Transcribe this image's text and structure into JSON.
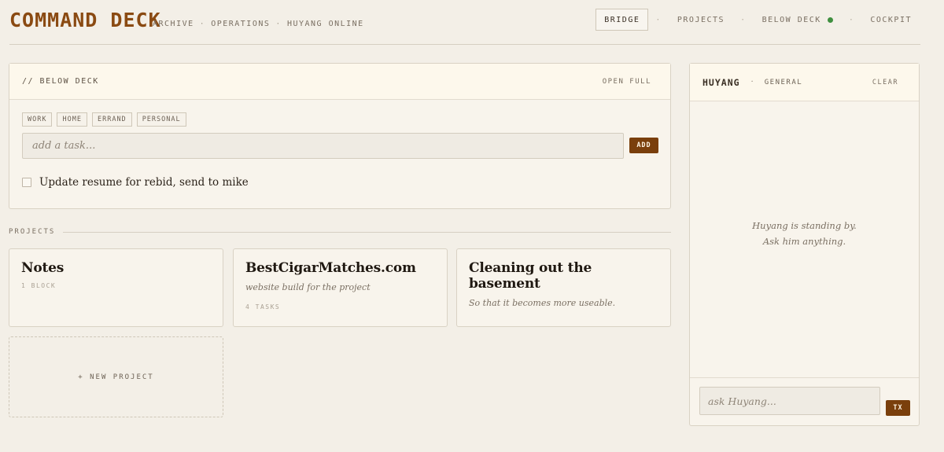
{
  "header": {
    "brand": "COMMAND DECK",
    "crumbs": [
      "ARCHIVE",
      "OPERATIONS",
      "HUYANG ONLINE"
    ],
    "crumb_separator": "·",
    "nav": {
      "bridge": "BRIDGE",
      "projects": "PROJECTS",
      "below_deck": "BELOW DECK",
      "cockpit": "COCKPIT",
      "separator": "·",
      "active": "bridge"
    }
  },
  "below_deck": {
    "title": "// BELOW DECK",
    "open_full": "OPEN FULL",
    "tags": [
      "WORK",
      "HOME",
      "ERRAND",
      "PERSONAL"
    ],
    "input_placeholder": "add a task...",
    "add_label": "ADD",
    "tasks": [
      {
        "text": "Update resume for rebid, send to mike",
        "done": false
      }
    ]
  },
  "projects": {
    "label": "PROJECTS",
    "cards": [
      {
        "title": "Notes",
        "description": "",
        "meta": "1 BLOCK"
      },
      {
        "title": "BestCigarMatches.com",
        "description": "website build for the project",
        "meta": "4 TASKS"
      },
      {
        "title": "Cleaning out the basement",
        "description": "So that it becomes more useable.",
        "meta": ""
      }
    ],
    "new_project": "+ NEW PROJECT"
  },
  "chat": {
    "name": "HUYANG",
    "separator": "·",
    "channel": "GENERAL",
    "clear": "CLEAR",
    "empty_line1": "Huyang is standing by.",
    "empty_line2": "Ask him anything.",
    "input_placeholder": "ask Huyang...",
    "send_label": "TX"
  },
  "colors": {
    "background": "#f3efe7",
    "brand": "#8a4a12",
    "button": "#7a3f0c",
    "status_online": "#3f8f3f"
  }
}
